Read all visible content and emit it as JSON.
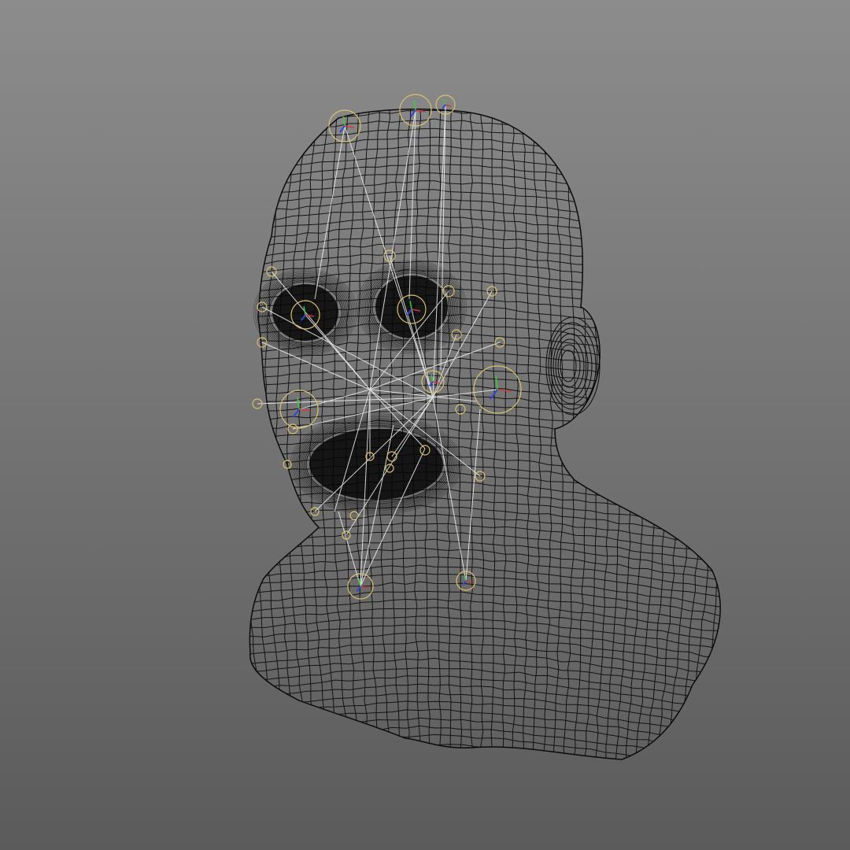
{
  "viewport": {
    "description_free": true,
    "background_top": "#8c8c8c",
    "background_bottom": "#5b5b5b",
    "wire_color": "#0b0b0b",
    "cavity_color": "#050505",
    "rig_line_color": "#f2f2f2",
    "handle_ring_color": "#d8c070",
    "axis_colors": {
      "x": "#d23a3a",
      "y": "#3ec83e",
      "z": "#3046d8"
    },
    "rig_handle_count": 30
  }
}
